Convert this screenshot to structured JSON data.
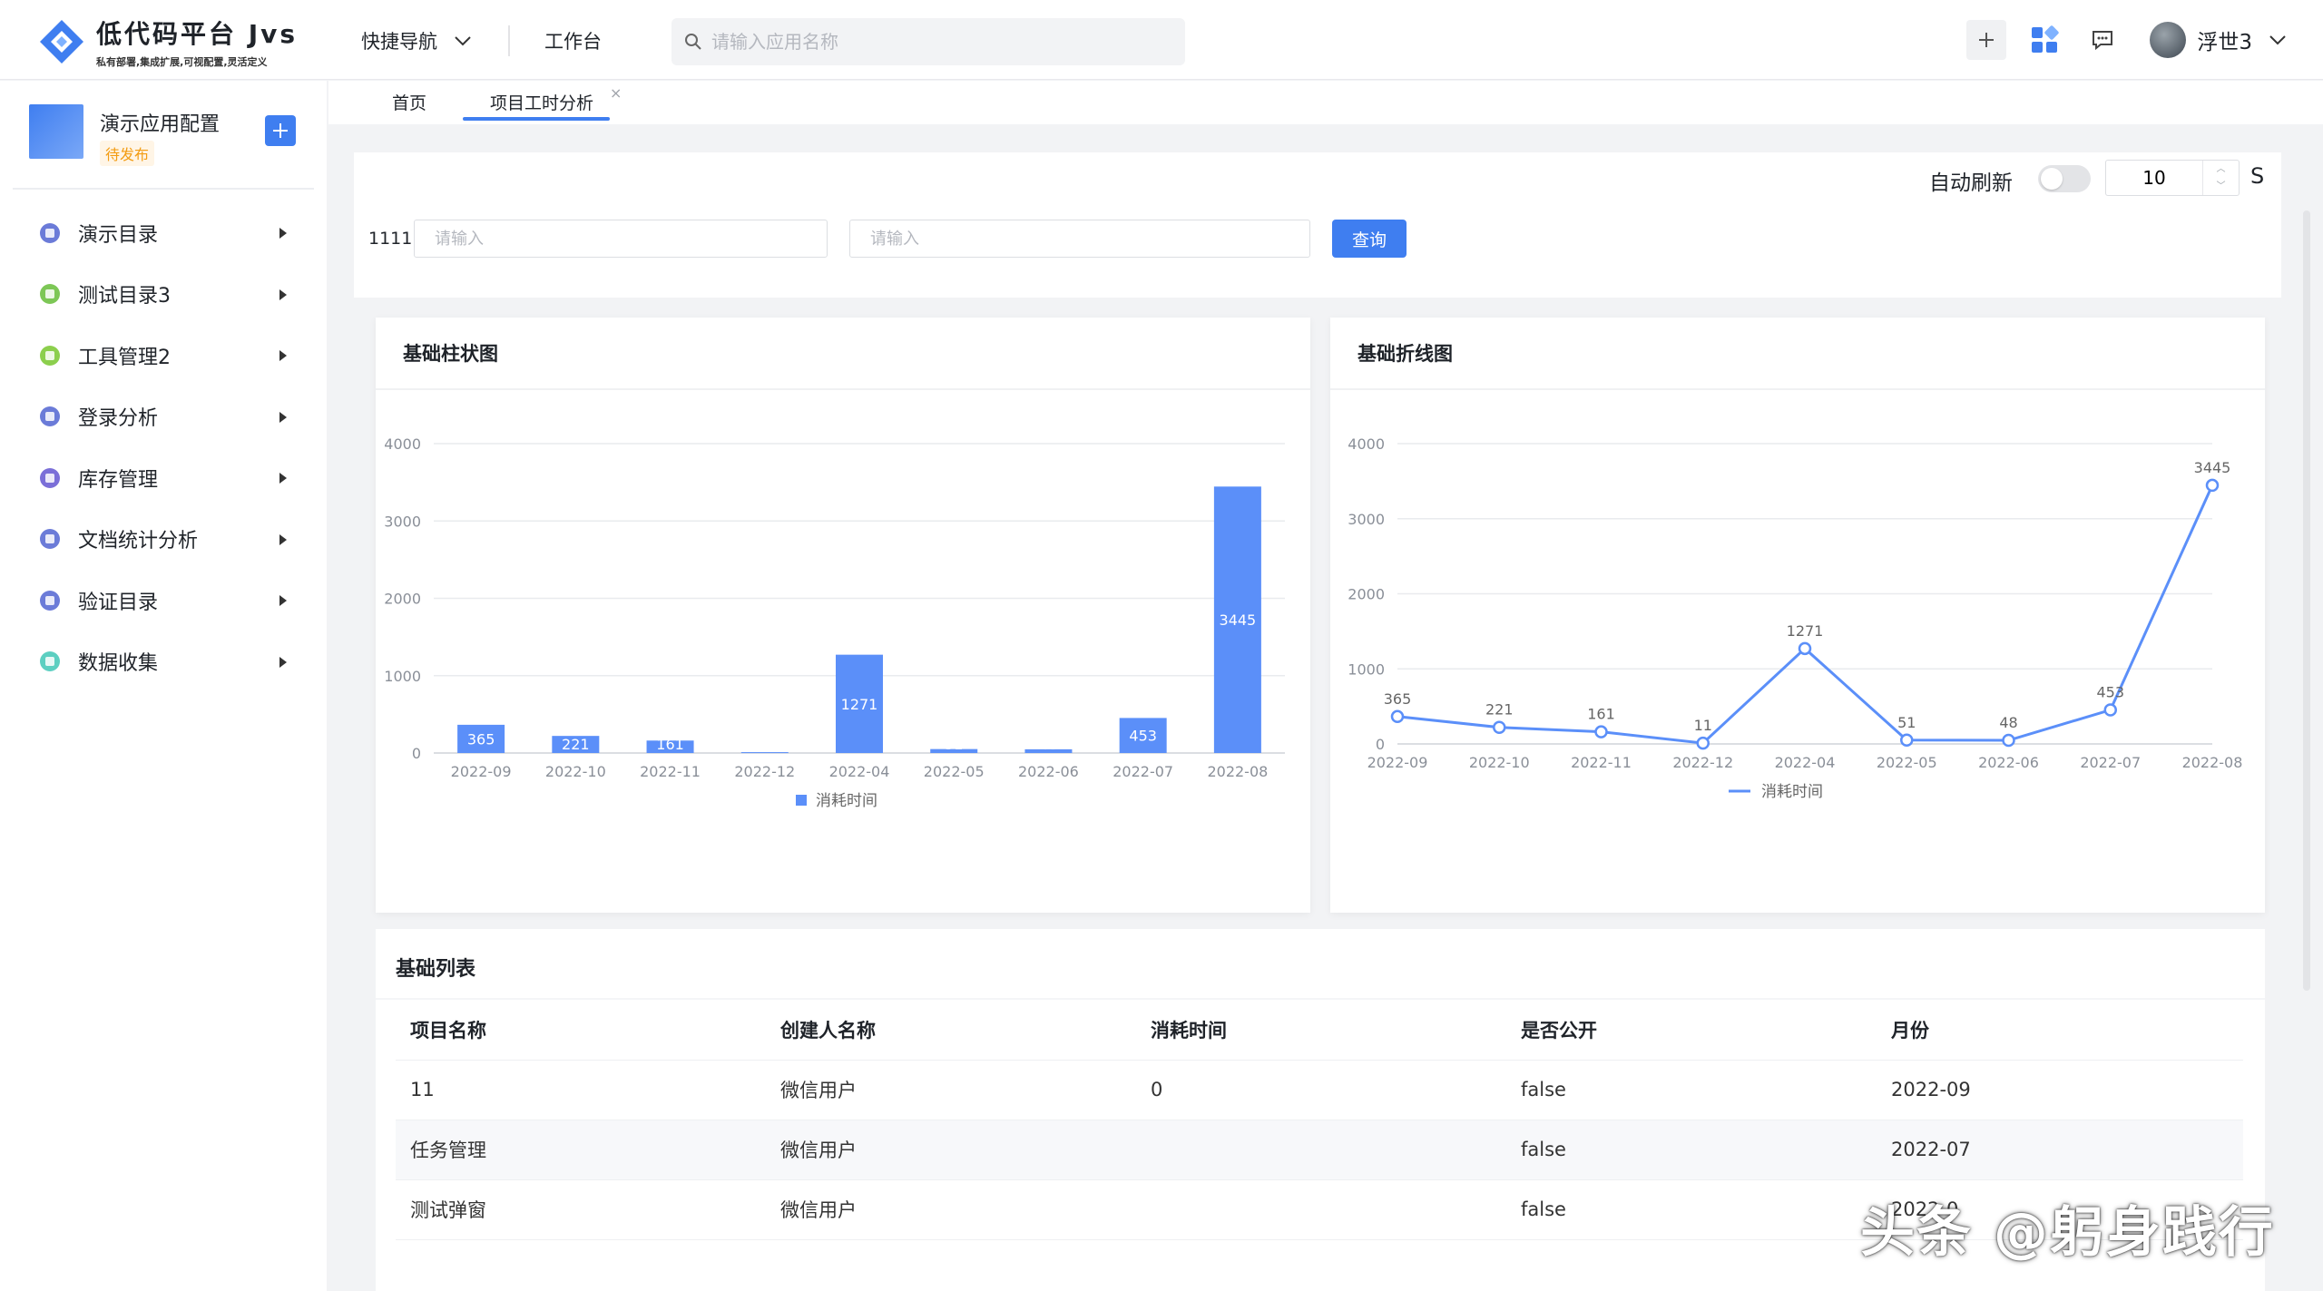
{
  "header": {
    "logo_title": "低代码平台 Jvs",
    "logo_subtitle": "私有部署,集成扩展,可视配置,灵活定义",
    "quick_nav": "快捷导航",
    "workbench": "工作台",
    "search_placeholder": "请输入应用名称",
    "user_name": "浮世3"
  },
  "sidebar": {
    "app_name": "演示应用配置",
    "app_status": "待发布",
    "items": [
      {
        "label": "演示目录",
        "color": "#6b7bd8"
      },
      {
        "label": "测试目录3",
        "color": "#7dc756"
      },
      {
        "label": "工具管理2",
        "color": "#8ccf4d"
      },
      {
        "label": "登录分析",
        "color": "#6b7bd8"
      },
      {
        "label": "库存管理",
        "color": "#7b6fd8"
      },
      {
        "label": "文档统计分析",
        "color": "#6b7bd8"
      },
      {
        "label": "验证目录",
        "color": "#6b7bd8"
      },
      {
        "label": "数据收集",
        "color": "#5ccfc1"
      }
    ]
  },
  "tabs": {
    "home": "首页",
    "active": "项目工时分析",
    "close": "×"
  },
  "filters": {
    "auto_refresh_label": "自动刷新",
    "refresh_interval": "10",
    "unit": "S",
    "field_label": "1111:",
    "input1_placeholder": "请输入",
    "input2_placeholder": "请输入",
    "query_button": "查询"
  },
  "charts": {
    "bar_title": "基础柱状图",
    "line_title": "基础折线图"
  },
  "chart_data": [
    {
      "type": "bar",
      "title": "基础柱状图",
      "categories": [
        "2022-09",
        "2022-10",
        "2022-11",
        "2022-12",
        "2022-04",
        "2022-05",
        "2022-06",
        "2022-07",
        "2022-08"
      ],
      "series": [
        {
          "name": "消耗时间",
          "values": [
            365,
            221,
            161,
            11,
            1271,
            51,
            48,
            453,
            3445
          ]
        }
      ],
      "ylim": [
        0,
        4000
      ],
      "yticks": [
        0,
        1000,
        2000,
        3000,
        4000
      ],
      "color": "#5b8ff9",
      "legend": "bottom"
    },
    {
      "type": "line",
      "title": "基础折线图",
      "categories": [
        "2022-09",
        "2022-10",
        "2022-11",
        "2022-12",
        "2022-04",
        "2022-05",
        "2022-06",
        "2022-07",
        "2022-08"
      ],
      "series": [
        {
          "name": "消耗时间",
          "values": [
            365,
            221,
            161,
            11,
            1271,
            51,
            48,
            453,
            3445
          ]
        }
      ],
      "ylim": [
        0,
        4000
      ],
      "yticks": [
        0,
        1000,
        2000,
        3000,
        4000
      ],
      "color": "#5b8ff9",
      "legend": "bottom"
    }
  ],
  "table": {
    "title": "基础列表",
    "columns": [
      "项目名称",
      "创建人名称",
      "消耗时间",
      "是否公开",
      "月份"
    ],
    "rows": [
      [
        "11",
        "微信用户",
        "0",
        "false",
        "2022-09"
      ],
      [
        "任务管理",
        "微信用户",
        "",
        "false",
        "2022-07"
      ],
      [
        "测试弹窗",
        "微信用户",
        "",
        "false",
        "2022-0"
      ]
    ]
  },
  "watermark": "头条 @躬身践行"
}
